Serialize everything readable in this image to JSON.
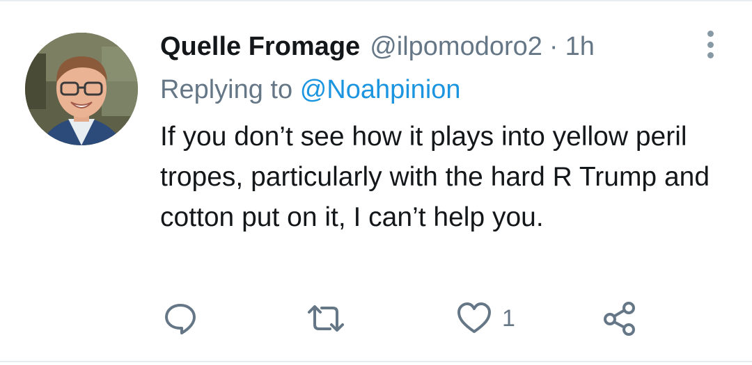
{
  "tweet": {
    "author_name": "Quelle Fromage",
    "handle": "@ilpomodoro2",
    "separator": "·",
    "time": "1h",
    "reply_prefix": "Replying to",
    "reply_mention": "@Noahpinion",
    "text": "If you don’t see how it plays into yellow peril tropes, particularly with the hard R Trump and cotton put on it, I can’t help you."
  },
  "actions": {
    "reply_icon": "reply-icon",
    "retweet_icon": "retweet-icon",
    "like_icon": "heart-icon",
    "like_count": "1",
    "share_icon": "share-icon"
  },
  "colors": {
    "text_primary": "#14171a",
    "text_secondary": "#657786",
    "link": "#1b95e0",
    "divider": "#e6ecf0"
  }
}
